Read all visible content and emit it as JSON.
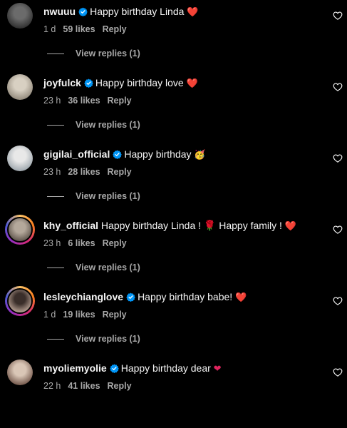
{
  "comments": [
    {
      "username": "nwuuu",
      "verified": true,
      "text": "Happy birthday Linda",
      "emoji": "❤️",
      "time": "1 d",
      "likes": "59 likes",
      "reply": "Reply",
      "view_replies": "View replies (1)"
    },
    {
      "username": "joyfulck",
      "verified": true,
      "text": "Happy birthday love",
      "emoji": "❤️",
      "time": "23 h",
      "likes": "36 likes",
      "reply": "Reply",
      "view_replies": "View replies (1)"
    },
    {
      "username": "gigilai_official",
      "verified": true,
      "text": "Happy birthday",
      "emoji": "🥳",
      "time": "23 h",
      "likes": "28 likes",
      "reply": "Reply",
      "view_replies": "View replies (1)"
    },
    {
      "username": "khy_official",
      "verified": false,
      "text": "Happy birthday Linda ! 🌹 Happy family !",
      "emoji": "❤️",
      "time": "23 h",
      "likes": "6 likes",
      "reply": "Reply",
      "view_replies": "View replies (1)"
    },
    {
      "username": "lesleychianglove",
      "verified": true,
      "text": "Happy birthday babe!",
      "emoji": "❤️",
      "time": "1 d",
      "likes": "19 likes",
      "reply": "Reply",
      "view_replies": "View replies (1)"
    },
    {
      "username": "myoliemyolie",
      "verified": true,
      "text": "Happy birthday dear",
      "emoji": "❤",
      "time": "22 h",
      "likes": "41 likes",
      "reply": "Reply",
      "view_replies": ""
    }
  ],
  "colors": {
    "background": "#000000",
    "text": "#f5f5f5",
    "secondary": "#a8a8a8",
    "verified": "#0095f6",
    "heart_emoji": "#e0245e"
  },
  "icons": {
    "verified": "verified-badge-icon",
    "like": "heart-outline-icon"
  }
}
